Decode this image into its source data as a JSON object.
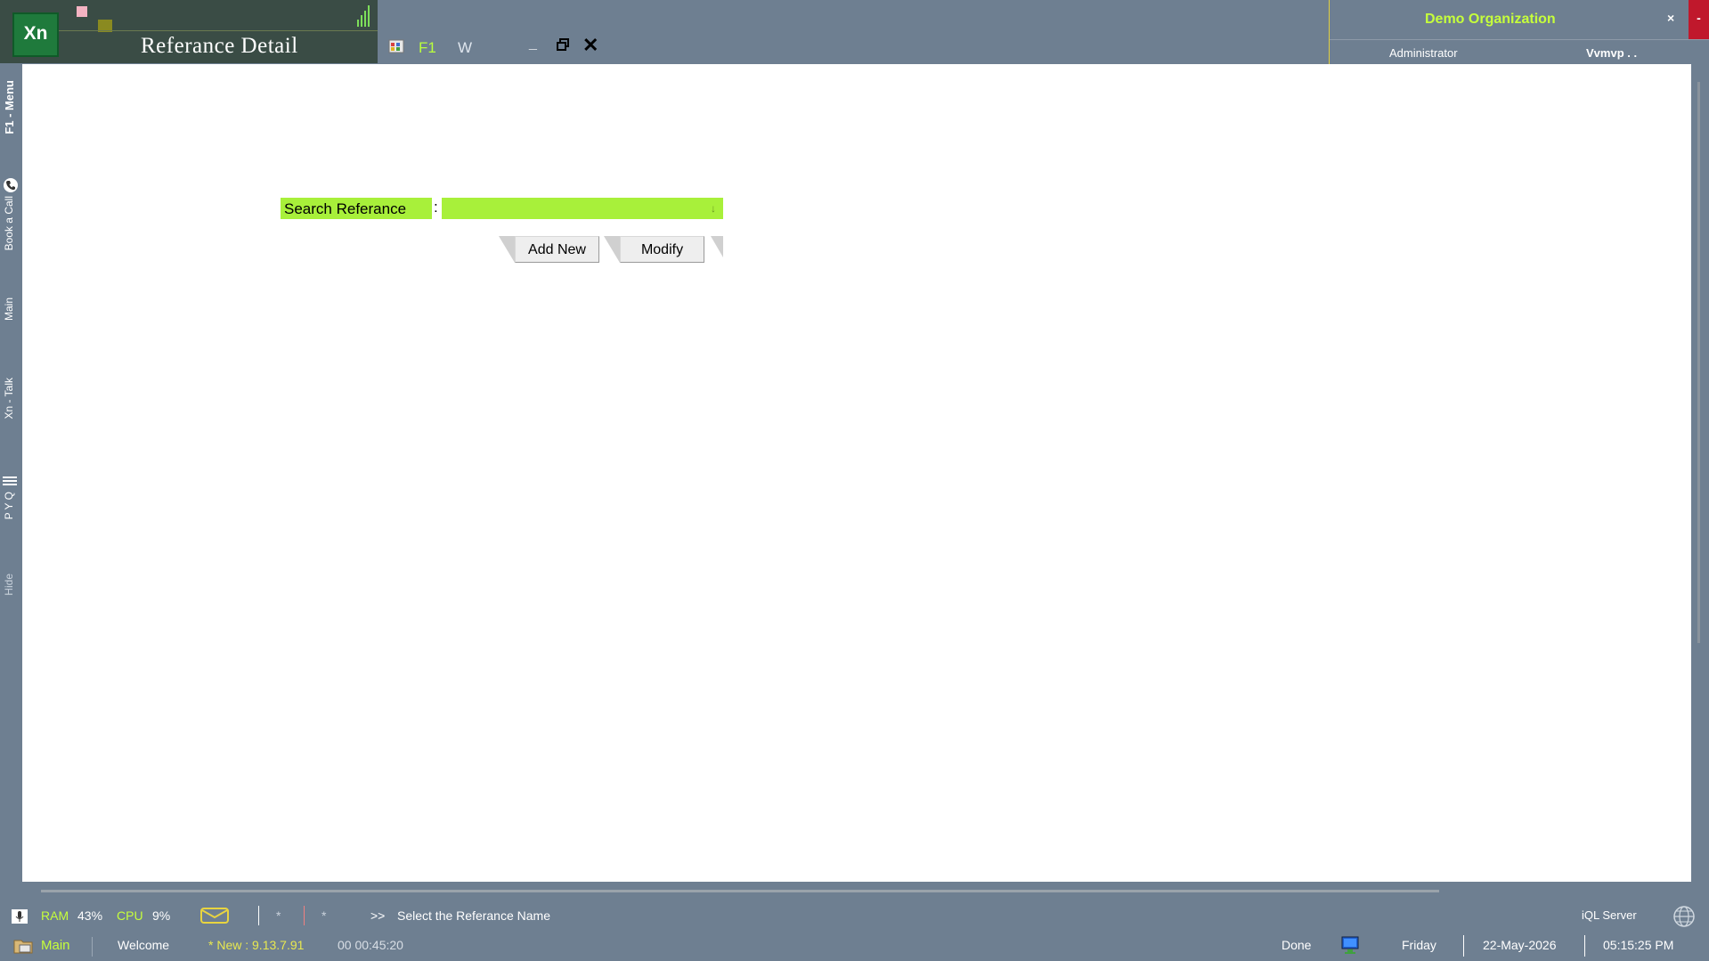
{
  "app": {
    "logo_text": "Xn",
    "title": "Referance Detail",
    "toolbar": {
      "f1": "F1",
      "w": "W",
      "minimize": "_",
      "close": "✕"
    }
  },
  "org": {
    "name": "Demo Organization",
    "role": "Administrator",
    "user": "Vvmvp . .",
    "close": "×",
    "minimize": "-"
  },
  "leftnav": {
    "menu": "F1 - Menu",
    "book_call": "Book a Call",
    "main": "Main",
    "xn_talk": "Xn - Talk",
    "pyq": "P Y Q",
    "hide": "Hide"
  },
  "form": {
    "search_label": "Search Referance",
    "colon": ":",
    "search_value": "",
    "dropdown_arrow": "↓",
    "add_new": "Add New",
    "modify": "Modify"
  },
  "status": {
    "ram_label": "RAM",
    "ram_value": "43%",
    "cpu_label": "CPU",
    "cpu_value": "9%",
    "star1": "*",
    "star2": "*",
    "prompt": ">>",
    "message": "Select the Referance Name",
    "server": "iQL Server",
    "main": "Main",
    "welcome": "Welcome",
    "version": "* New : 9.13.7.91",
    "elapsed": "00 00:45:20",
    "done": "Done",
    "day": "Friday",
    "date": "22-May-2026",
    "time": "05:15:25 PM"
  },
  "colors": {
    "accent_green": "#a8f03a",
    "background": "#6e7f91",
    "title_block": "#3a4c45",
    "close_red": "#c0182c"
  }
}
